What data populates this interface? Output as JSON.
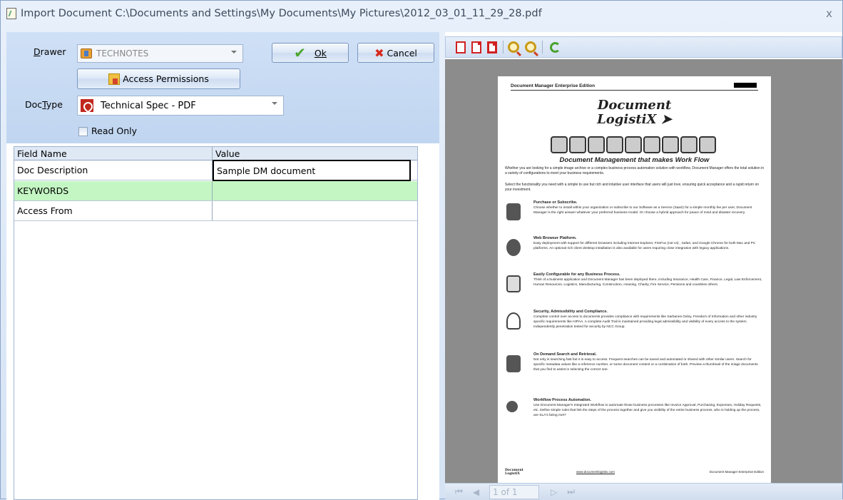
{
  "window": {
    "title": "Import Document C:\\Documents and Settings\\My Documents\\My Pictures\\2012_03_01_11_29_28.pdf",
    "close": "x"
  },
  "form": {
    "drawer_label": "Drawer",
    "drawer_value": "TECHNOTES",
    "ok_label": "Ok",
    "cancel_label": "Cancel",
    "access_permissions_label": "Access Permissions",
    "doctype_label": "DocType",
    "doctype_value": "Technical Spec - PDF",
    "read_only_label": "Read Only"
  },
  "grid": {
    "headers": [
      "Field Name",
      "Value"
    ],
    "rows": [
      {
        "field": "Doc Description",
        "value": "Sample DM document"
      },
      {
        "field": "KEYWORDS",
        "value": ""
      },
      {
        "field": "Access From",
        "value": ""
      }
    ]
  },
  "viewer": {
    "nav_first": "⏮",
    "nav_prev": "◀",
    "page_indicator": "1 of 1",
    "nav_next": "▷",
    "nav_last": "⏭"
  },
  "pdf": {
    "header": "Document Manager Enterprise Edition",
    "logo_line1": "Document",
    "logo_line2": "LogistiX",
    "tagline": "Document Management that makes Work Flow",
    "intro": "Whether you are looking for a simple image archive or a complex business process automation solution with workflow, Document Manager offers the total solution in a variety of configurations to meet your business requirements.",
    "intro2": "Select the functionality you need with a simple to use but rich and intuitive user interface that users will just love, ensuring quick acceptance and a rapid return on your investment.",
    "sections": [
      {
        "title": "Purchase or Subscribe.",
        "body": "Choose whether to install within your organization or subscribe to our Software as a Service (SaaS) for a simple monthly fee per user, Document Manager is the right answer whatever your preferred business model. Or choose a hybrid approach for peace of mind and disaster recovery."
      },
      {
        "title": "Web Browser Platform.",
        "body": "Easy deployment with support for different browsers including Internet Explorer, FireFox (not v4) , Safari, and Google Chrome for both Mac and PC platforms. An optional rich client desktop installation is also available for users requiring close integration with legacy applications."
      },
      {
        "title": "Easily Configurable for any Business Process.",
        "body": "Think of a business application and Document Manager has been deployed there, including Insurance, Health Care, Finance, Legal, Law Enforcement, Human Resources, Logistics, Manufacturing, Construction, Housing, Charity, Fire Service, Pensions and countless others."
      },
      {
        "title": "Security, Admissibility and Compliance.",
        "body": "Complete control over access to documents provides compliance with requirements like Sarbanes Oxley, Freedom of Information and other industry specific requirements like HIPAA. A complete Audit Trail is maintained providing legal admissibility and visibility of every access to the system. Independently penetration tested for security by NCC Group."
      },
      {
        "title": "On Demand Search and Retrieval.",
        "body": "Not only is searching fast but it is easy to access. Frequent searches can be saved and automated or shared with other similar users. Search for specific metadata values like a reference number, or some document content or a combination of both. Preview a thumbnail of the image documents that you find to assist in selecting the correct one."
      },
      {
        "title": "Workflow Process Automation.",
        "body": "Use Document Manager's Integrated Workflow to automate those business processes like Invoice Approval, Purchasing, Expenses, Holiday Requests, etc. Define simple rules that link the steps of the process together and give you visibility of the entire business process, who is holding up the process, are SLA's being met?"
      }
    ],
    "footer_logo": "Document LogistiX",
    "footer_url": "www.documentlogistix.com",
    "footer_edition": "Document Manager Enterprise Edition"
  }
}
